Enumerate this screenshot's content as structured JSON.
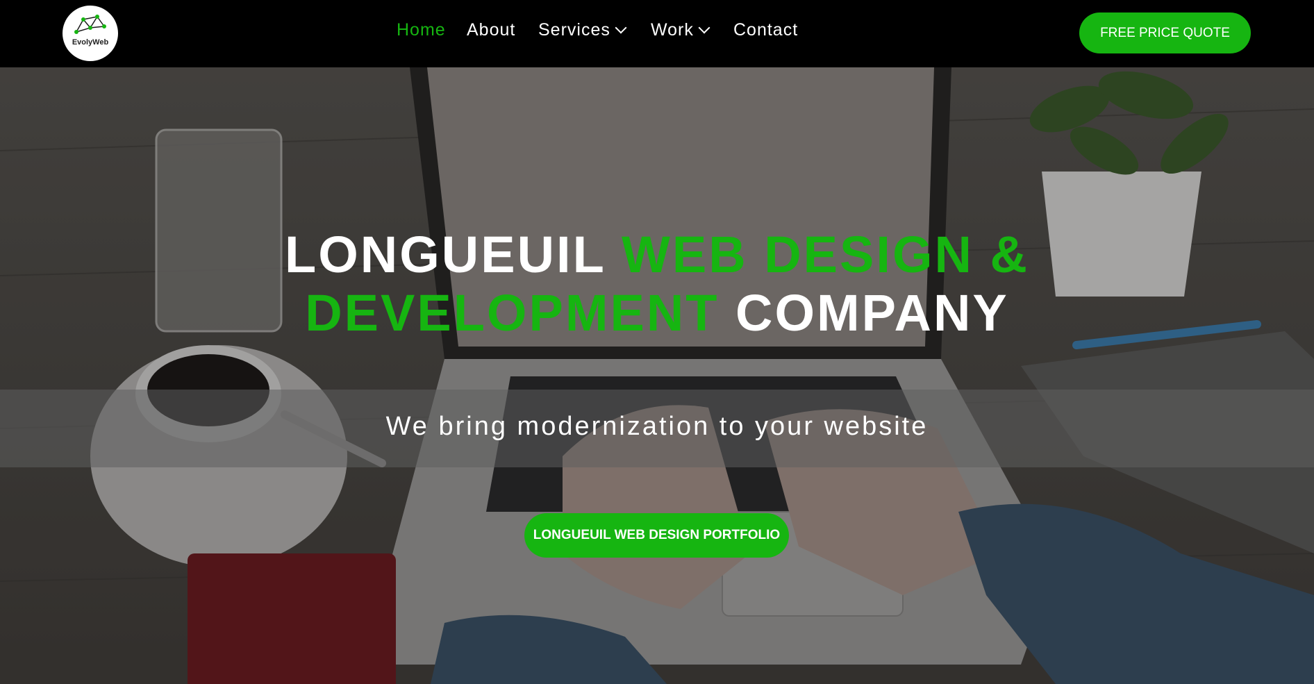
{
  "brand": {
    "logo_text": "EvolyWeb"
  },
  "colors": {
    "accent": "#16b511",
    "nav_bg": "#000000",
    "text": "#ffffff"
  },
  "nav": {
    "items": [
      {
        "label": "Home",
        "active": true
      },
      {
        "label": "About"
      },
      {
        "label": "Services",
        "dropdown": true
      },
      {
        "label": "Work",
        "dropdown": true
      },
      {
        "label": "Contact"
      }
    ]
  },
  "header": {
    "cta_label": "FREE PRICE QUOTE"
  },
  "hero": {
    "headline": {
      "part1": "LONGUEUIL ",
      "part2": "WEB DESIGN &",
      "part3": "DEVELOPMENT",
      "part4": " COMPANY"
    },
    "subtitle": "We bring modernization to your website",
    "cta_label": "LONGUEUIL WEB DESIGN PORTFOLIO"
  }
}
